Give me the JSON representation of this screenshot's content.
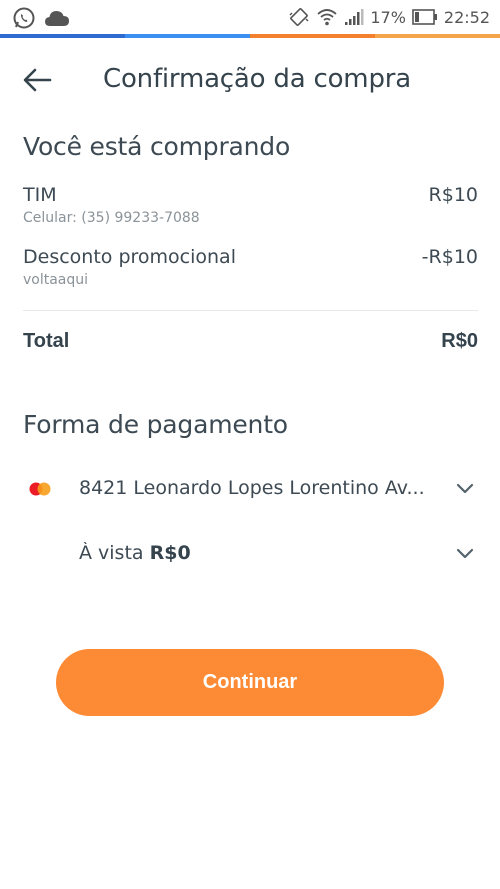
{
  "status_bar": {
    "battery": "17%",
    "time": "22:52",
    "strip_colors": [
      "#2f6bd1",
      "#3a8ff0",
      "#f2802c",
      "#f4a44a"
    ],
    "icons": [
      "whatsapp-icon",
      "cloud-icon",
      "vibrate-icon",
      "wifi-icon",
      "signal-icon",
      "battery-icon"
    ]
  },
  "header": {
    "title": "Confirmação da compra"
  },
  "purchase": {
    "heading": "Você está comprando",
    "items": [
      {
        "name": "TIM",
        "sub": "Celular: (35) 99233-7088",
        "amount": "R$10"
      },
      {
        "name": "Desconto promocional",
        "sub": "voltaaqui",
        "amount": "-R$10"
      }
    ],
    "total_label": "Total",
    "total_value": "R$0"
  },
  "payment": {
    "heading": "Forma de pagamento",
    "card_text": "8421 Leonardo Lopes Lorentino Av...",
    "installment_prefix": "À vista ",
    "installment_value": "R$0"
  },
  "continue_label": "Continuar",
  "colors": {
    "accent": "#fd8a35",
    "text": "#3d4a53",
    "muted": "#8a9399"
  }
}
